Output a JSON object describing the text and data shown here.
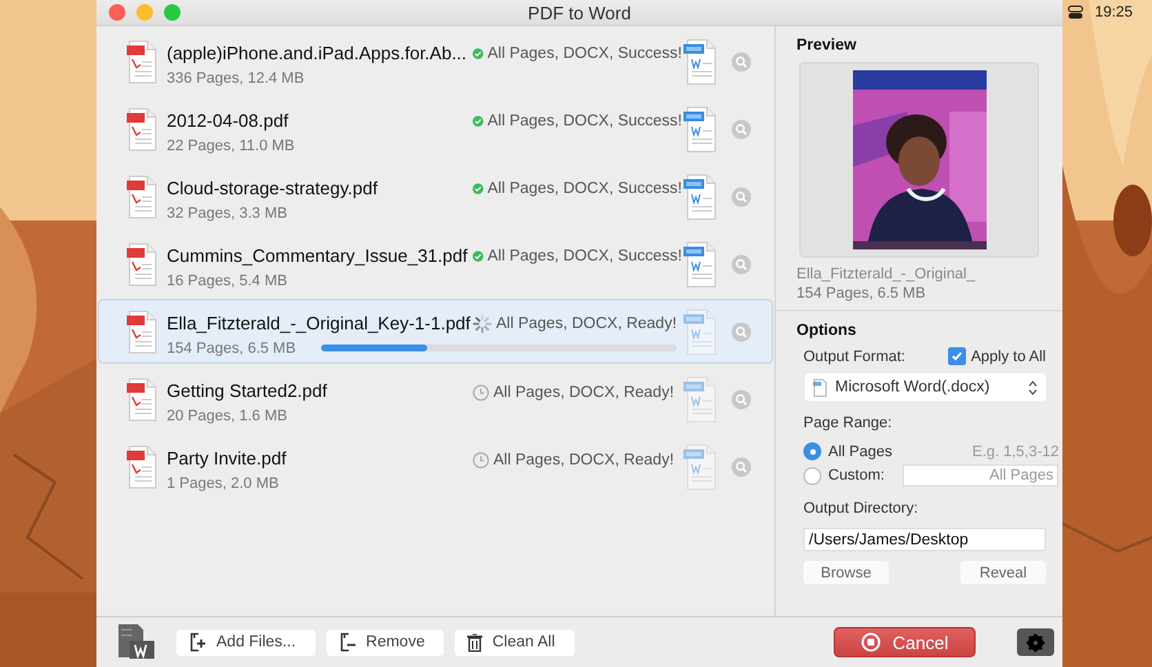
{
  "window": {
    "title": "PDF to Word"
  },
  "menu_bar": {
    "clock": "19:25"
  },
  "files": [
    {
      "name": "(apple)iPhone.and.iPad.Apps.for.Ab...",
      "info": "336 Pages, 12.4 MB",
      "status": "All Pages, DOCX, Success!",
      "kind": "success",
      "selected": false
    },
    {
      "name": "2012-04-08.pdf",
      "info": "22 Pages, 11.0 MB",
      "status": "All Pages, DOCX, Success!",
      "kind": "success",
      "selected": false
    },
    {
      "name": "Cloud-storage-strategy.pdf",
      "info": "32 Pages, 3.3 MB",
      "status": "All Pages, DOCX, Success!",
      "kind": "success",
      "selected": false
    },
    {
      "name": "Cummins_Commentary_Issue_31.pdf",
      "info": "16 Pages, 5.4 MB",
      "status": "All Pages, DOCX, Success!",
      "kind": "success",
      "selected": false
    },
    {
      "name": "Ella_Fitzterald_-_Original_Key-1-1.pdf",
      "info": "154 Pages, 6.5 MB",
      "status": "All Pages, DOCX, Ready!",
      "kind": "converting",
      "level": 0.3,
      "selected": true
    },
    {
      "name": "Getting Started2.pdf",
      "info": "20 Pages, 1.6 MB",
      "status": "All Pages, DOCX, Ready!",
      "kind": "waiting",
      "selected": false
    },
    {
      "name": "Party Invite.pdf",
      "info": "1 Pages, 2.0 MB",
      "status": "All Pages, DOCX, Ready!",
      "kind": "waiting",
      "selected": false
    }
  ],
  "toolbar": [
    {
      "label": "Add Files...",
      "kind": "add"
    },
    {
      "label": "Remove",
      "kind": "remove"
    },
    {
      "label": "Clean All",
      "kind": "clean"
    }
  ],
  "preview": {
    "heading": "Preview",
    "file_name": "Ella_Fitzterald_-_Original_",
    "info": "154 Pages, 6.5 MB"
  },
  "options": {
    "heading": "Options",
    "output_format_label": "Output Format:",
    "apply_to_all": {
      "label": "Apply to All",
      "checked": true
    },
    "format": "Microsoft Word(.docx)",
    "page_range_label": "Page Range:",
    "range_options": [
      {
        "label": "All Pages",
        "selected": true
      },
      {
        "label": "Custom:",
        "selected": false
      }
    ],
    "hint": "E.g. 1,5,3-12",
    "custom_placeholder": "All Pages",
    "output_directory_label": "Output Directory:",
    "output_directory": "/Users/James/Desktop",
    "browse": "Browse",
    "reveal": "Reveal"
  },
  "cancel": "Cancel"
}
